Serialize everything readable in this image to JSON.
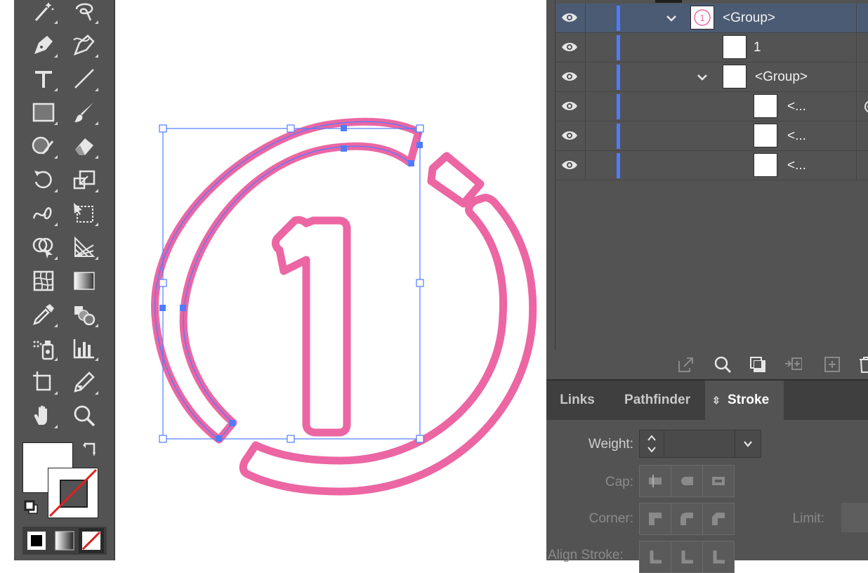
{
  "layers": {
    "rows": [
      {
        "name": "<Group>",
        "expanded": true,
        "selected": true
      },
      {
        "name": "1",
        "expanded": null,
        "selected": false
      },
      {
        "name": "<Group>",
        "expanded": true,
        "selected": false
      },
      {
        "name": "<...",
        "expanded": null,
        "selected": false
      },
      {
        "name": "<...",
        "expanded": null,
        "selected": false
      },
      {
        "name": "<...",
        "expanded": null,
        "selected": false
      }
    ],
    "footer_icons": [
      "export-icon",
      "search-icon",
      "clipping-mask-icon",
      "move-to-layer-icon",
      "new-sublayer-icon",
      "trash-icon"
    ]
  },
  "tabs": {
    "links": "Links",
    "pathfinder": "Pathfinder",
    "stroke": "Stroke",
    "active": "Stroke"
  },
  "stroke": {
    "weight_label": "Weight:",
    "weight_value": "",
    "cap_label": "Cap:",
    "corner_label": "Corner:",
    "limit_label": "Limit:",
    "align_label": "Align Stroke:"
  },
  "colors": {
    "artwork_stroke": "#ec66a3",
    "selection": "#4f7cff",
    "ui_bg": "#535353",
    "selected_row": "#4b5b74"
  },
  "toolbar": {
    "tools": [
      "magic-wand",
      "lasso",
      "pen",
      "curvature",
      "type",
      "line-segment",
      "rectangle",
      "paintbrush",
      "shaper",
      "eraser",
      "rotate",
      "scale",
      "warp",
      "free-transform",
      "shape-builder",
      "perspective-grid",
      "mesh",
      "gradient",
      "eyedropper",
      "blend",
      "symbol-sprayer",
      "column-graph",
      "artboard",
      "slice",
      "hand",
      "zoom"
    ]
  }
}
